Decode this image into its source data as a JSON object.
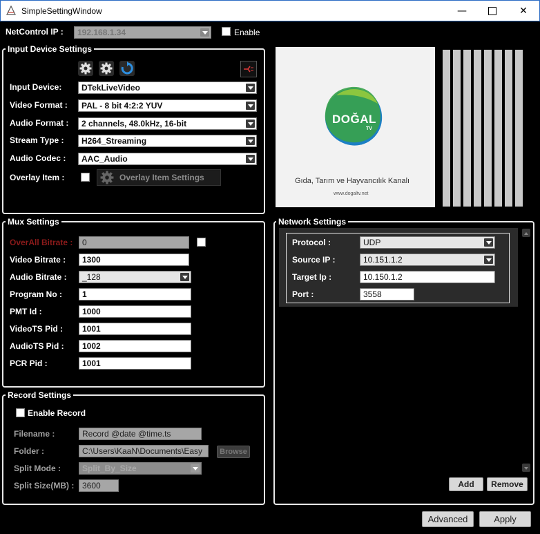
{
  "window": {
    "title": "SimpleSettingWindow"
  },
  "netcontrol": {
    "label": "NetControl IP :",
    "ip": "192.168.1.34",
    "enable_label": "Enable"
  },
  "input_device": {
    "title": "Input Device Settings",
    "rows": [
      {
        "label": "Input Device:",
        "value": "DTekLiveVideo"
      },
      {
        "label": "Video Format :",
        "value": "PAL - 8 bit 4:2:2 YUV"
      },
      {
        "label": "Audio Format :",
        "value": "2 channels, 48.0kHz, 16-bit"
      },
      {
        "label": "Stream Type :",
        "value": "H264_Streaming"
      },
      {
        "label": "Audio Codec :",
        "value": "AAC_Audio"
      }
    ],
    "overlay_label": "Overlay Item :",
    "overlay_button": "Overlay Item Settings"
  },
  "preview": {
    "brand": "DOĞAL",
    "brand_sub": "TV",
    "tagline": "Gıda, Tarım ve Hayvancılık Kanalı",
    "url": "www.dogaltv.net"
  },
  "mux": {
    "title": "Mux Settings",
    "overall_label": "OverAll Bitrate :",
    "overall_value": "0",
    "video_bitrate_label": "Video Bitrate :",
    "video_bitrate_value": "1300",
    "audio_bitrate_label": "Audio Bitrate :",
    "audio_bitrate_value": "_128",
    "program_label": "Program No :",
    "program_value": "1",
    "pmt_label": "PMT Id :",
    "pmt_value": "1000",
    "video_ts_label": "VideoTS Pid :",
    "video_ts_value": "1001",
    "audio_ts_label": "AudioTS Pid :",
    "audio_ts_value": "1002",
    "pcr_label": "PCR Pid :",
    "pcr_value": "1001"
  },
  "network": {
    "title": "Network Settings",
    "protocol_label": "Protocol :",
    "protocol_value": "UDP",
    "source_label": "Source IP :",
    "source_value": "10.151.1.2",
    "target_label": "Target Ip :",
    "target_value": "10.150.1.2",
    "port_label": "Port :",
    "port_value": "3558",
    "add_label": "Add",
    "remove_label": "Remove"
  },
  "record": {
    "title": "Record Settings",
    "enable_label": "Enable Record",
    "filename_label": "Filename :",
    "filename_value": "Record @date @time.ts",
    "folder_label": "Folder :",
    "folder_value": "C:\\Users\\KaaN\\Documents\\Easy",
    "browse_label": "Browse",
    "split_mode_label": "Split Mode :",
    "split_mode_value": "Split_By_Size",
    "split_size_label": "Split Size(MB) :",
    "split_size_value": "3600"
  },
  "footer": {
    "advanced_label": "Advanced",
    "apply_label": "Apply"
  },
  "colors": {
    "logo_green": "#3aa34a",
    "logo_blue": "#1c7fc4",
    "accent_red": "#c0392b"
  }
}
